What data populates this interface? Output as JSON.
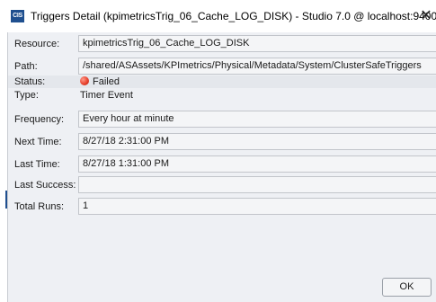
{
  "window": {
    "app_icon_text": "CIS",
    "title": "Triggers Detail (kpimetricsTrig_06_Cache_LOG_DISK) - Studio 7.0 @ localhost:9400",
    "close_glyph": "✕"
  },
  "fields": {
    "resource": {
      "label": "Resource:",
      "value": "kpimetricsTrig_06_Cache_LOG_DISK"
    },
    "path": {
      "label": "Path:",
      "value": "/shared/ASAssets/KPImetrics/Physical/Metadata/System/ClusterSafeTriggers"
    },
    "status": {
      "label": "Status:",
      "value": "Failed",
      "icon": "red-status-dot-icon",
      "color": "#e8432f"
    },
    "type": {
      "label": "Type:",
      "value": "Timer Event"
    },
    "frequency": {
      "label": "Frequency:",
      "value": "Every hour at minute"
    },
    "next_time": {
      "label": "Next Time:",
      "value": "8/27/18 2:31:00 PM"
    },
    "last_time": {
      "label": "Last Time:",
      "value": "8/27/18 1:31:00 PM"
    },
    "last_success": {
      "label": "Last Success:",
      "value": ""
    },
    "total_runs": {
      "label": "Total Runs:",
      "value": "1"
    }
  },
  "buttons": {
    "ok_label": "OK"
  }
}
